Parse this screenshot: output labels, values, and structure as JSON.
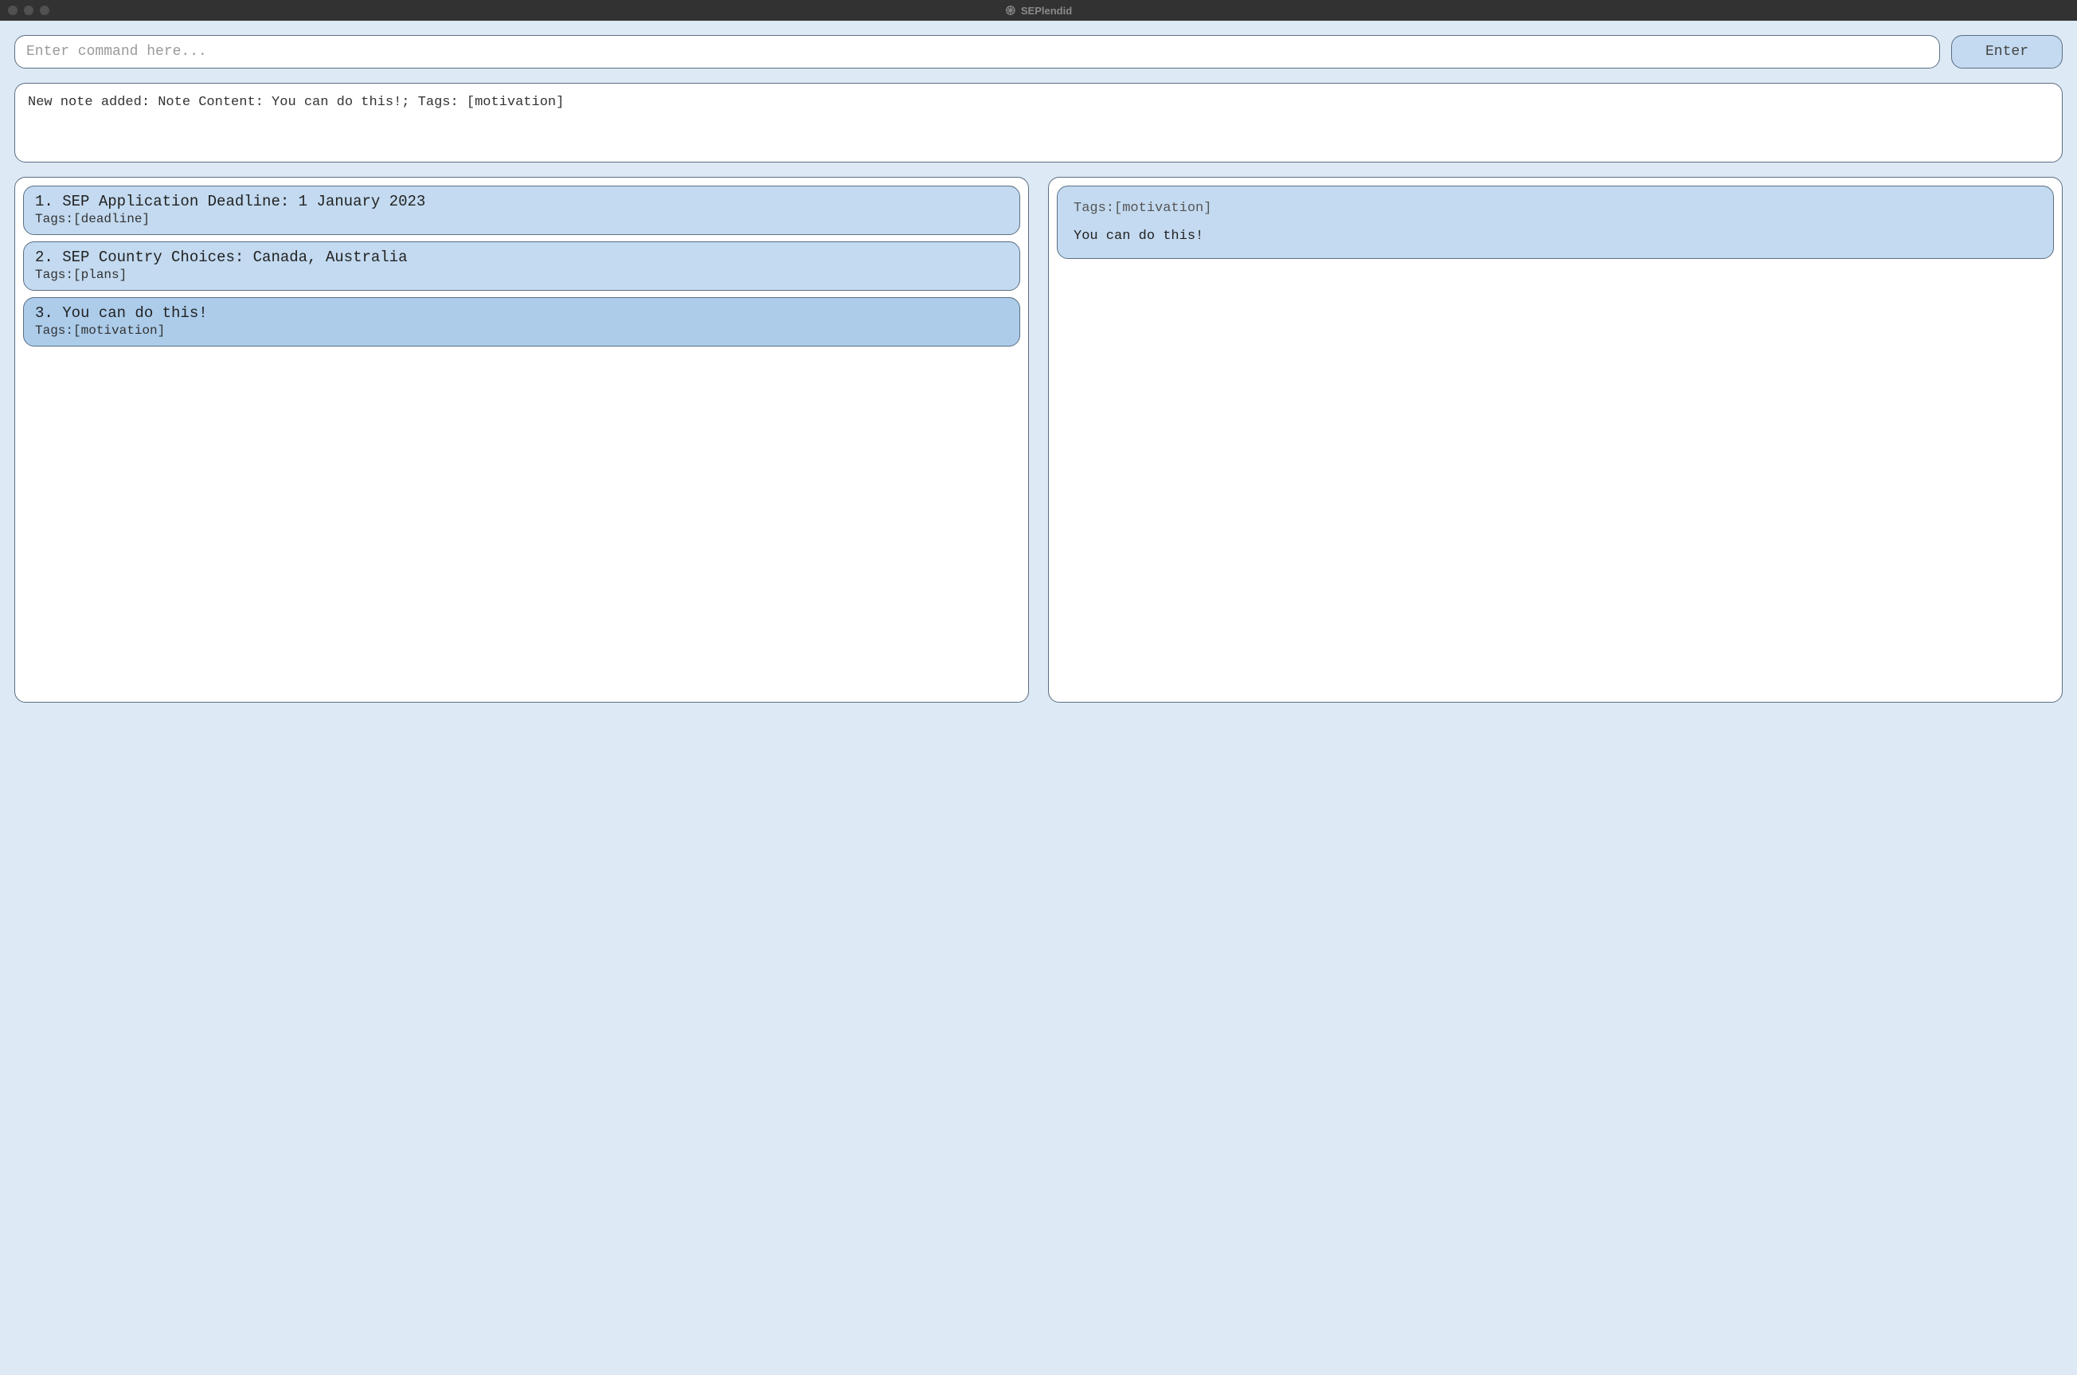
{
  "window": {
    "title": "SEPlendid"
  },
  "command": {
    "placeholder": "Enter command here...",
    "value": "",
    "enter_label": "Enter"
  },
  "feedback": {
    "text": "New note added: Note Content: You can do this!; Tags: [motivation]"
  },
  "notes": [
    {
      "index": "1.",
      "title": "SEP Application Deadline: 1 January 2023",
      "tags": "Tags:[deadline]",
      "selected": false
    },
    {
      "index": "2.",
      "title": "SEP Country Choices: Canada, Australia",
      "tags": "Tags:[plans]",
      "selected": false
    },
    {
      "index": "3.",
      "title": "You can do this!",
      "tags": "Tags:[motivation]",
      "selected": true
    }
  ],
  "detail": {
    "tags": "Tags:[motivation]",
    "content": "You can do this!"
  }
}
